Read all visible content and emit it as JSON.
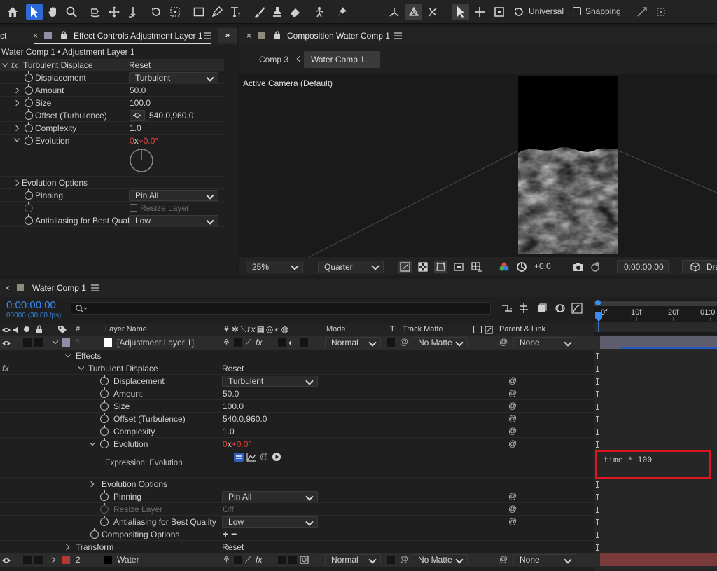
{
  "toolbar": {
    "universal_label": "Universal",
    "snapping_label": "Snapping"
  },
  "effect_controls": {
    "tab_left_fragment": "ct",
    "tab_title": "Effect Controls Adjustment Layer 1",
    "breadcrumb": "Water Comp 1 • Adjustment Layer 1",
    "effect_name": "Turbulent Displace",
    "reset_label": "Reset",
    "props": [
      {
        "name": "Displacement",
        "value": "Turbulent"
      },
      {
        "name": "Amount",
        "value": "50.0"
      },
      {
        "name": "Size",
        "value": "100.0"
      },
      {
        "name": "Offset (Turbulence)",
        "value": "540.0,960.0"
      },
      {
        "name": "Complexity",
        "value": "1.0"
      },
      {
        "name": "Evolution",
        "value_x": "0",
        "value_sep": "x",
        "value_deg": "+0.0°"
      }
    ],
    "evolution_options_label": "Evolution Options",
    "pinning": {
      "name": "Pinning",
      "value": "Pin All"
    },
    "resize_layer_label": "Resize Layer",
    "antialiasing": {
      "name": "Antialiasing for Best Quali",
      "value": "Low"
    }
  },
  "composition": {
    "tab_title": "Composition Water Comp 1",
    "breadcrumb_comp3": "Comp 3",
    "breadcrumb_current": "Water Comp 1",
    "camera_label": "Active Camera (Default)",
    "zoom": "25%",
    "resolution": "Quarter",
    "exposure": "+0.0",
    "timecode": "0:00:00:00",
    "draft_fragment": "Dra"
  },
  "timeline": {
    "tab_title": "Water Comp 1",
    "current_time": "0:00:00:00",
    "frame_info": "00000 (30.00 fps)",
    "search_placeholder": "",
    "col_hash": "#",
    "col_layer_name": "Layer Name",
    "col_mode": "Mode",
    "col_t": "T",
    "col_track_matte": "Track Matte",
    "col_parent": "Parent & Link",
    "ruler_labels": [
      "0f",
      "10f",
      "20f",
      "01:0"
    ],
    "layers": [
      {
        "num": "1",
        "name": "[Adjustment Layer 1]",
        "mode": "Normal",
        "matte": "No Matte",
        "parent": "None",
        "color": "#8e8ea8"
      },
      {
        "num": "2",
        "name": "Water",
        "mode": "Normal",
        "matte": "No Matte",
        "parent": "None",
        "color": "#b03a3a"
      }
    ],
    "effects_label": "Effects",
    "effect_name": "Turbulent Displace",
    "reset_label": "Reset",
    "props": [
      {
        "name": "Displacement",
        "value": "Turbulent"
      },
      {
        "name": "Amount",
        "value": "50.0"
      },
      {
        "name": "Size",
        "value": "100.0"
      },
      {
        "name": "Offset (Turbulence)",
        "value": "540.0,960.0"
      },
      {
        "name": "Complexity",
        "value": "1.0"
      },
      {
        "name": "Evolution",
        "value_x": "0",
        "value_sep": "x",
        "value_deg": "+0.0°"
      }
    ],
    "expression_label": "Expression: Evolution",
    "expression_text": "time * 100",
    "evolution_options_label": "Evolution Options",
    "pinning": {
      "name": "Pinning",
      "value": "Pin All"
    },
    "resize_layer": {
      "name": "Resize Layer",
      "value": "Off"
    },
    "antialiasing": {
      "name": "Antialiasing for Best Quality",
      "value": "Low"
    },
    "compositing_label": "Compositing Options",
    "compositing_ops": "+ −",
    "transform_label": "Transform"
  }
}
